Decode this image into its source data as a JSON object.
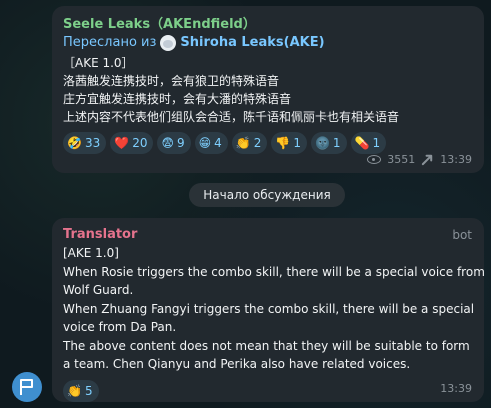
{
  "message1": {
    "sender": "Seele Leaks（AKEndfield）",
    "forward_prefix": "Переслано из",
    "forward_source": "Shiroha Leaks(AKE)",
    "lines": [
      "［AKE 1.0］",
      "洛茜触发连携技时，会有狼卫的特殊语音",
      "庄方宜触发连携技时，会有大潘的特殊语音",
      "上述内容不代表他们组队会合适，陈千语和佩丽卡也有相关语音"
    ],
    "reactions": [
      {
        "emoji": "🤣",
        "icon": "rofl-emoji",
        "count": "33"
      },
      {
        "emoji": "❤️",
        "icon": "heart-emoji",
        "count": "20"
      },
      {
        "emoji": "😨",
        "icon": "fearful-emoji",
        "count": "9"
      },
      {
        "emoji": "😁",
        "icon": "grin-emoji",
        "count": "4"
      },
      {
        "emoji": "👏",
        "icon": "clap-emoji",
        "count": "2"
      },
      {
        "emoji": "👎",
        "icon": "thumbs-down-emoji",
        "count": "1"
      },
      {
        "emoji": "🌚",
        "icon": "moon-face-emoji",
        "count": "1"
      },
      {
        "emoji": "💊",
        "icon": "pill-emoji",
        "count": "1"
      }
    ],
    "views": "3551",
    "time": "13:39"
  },
  "discussion_label": "Начало обсуждения",
  "message2": {
    "sender": "Translator",
    "tag": "bot",
    "lines": [
      "[AKE 1.0]",
      "When Rosie triggers the combo skill, there will be a special voice from",
      "Wolf Guard.",
      "When Zhuang Fangyi triggers the combo skill, there will be a special",
      "voice from Da Pan.",
      "The above content does not mean that they will be suitable to form",
      "a team. Chen Qianyu and Perika also have related voices."
    ],
    "reactions": [
      {
        "emoji": "👏",
        "icon": "clap-emoji",
        "count": "5"
      }
    ],
    "time": "13:39"
  },
  "colors": {
    "background": "#0f1a1f",
    "bubble": "#22292f",
    "sender_green": "#7dcf8a",
    "forward_blue": "#79c7ff",
    "translator_pink": "#e5738d",
    "reaction_bg": "#2c3b45",
    "avatar_blue": "#3f8fcf"
  }
}
